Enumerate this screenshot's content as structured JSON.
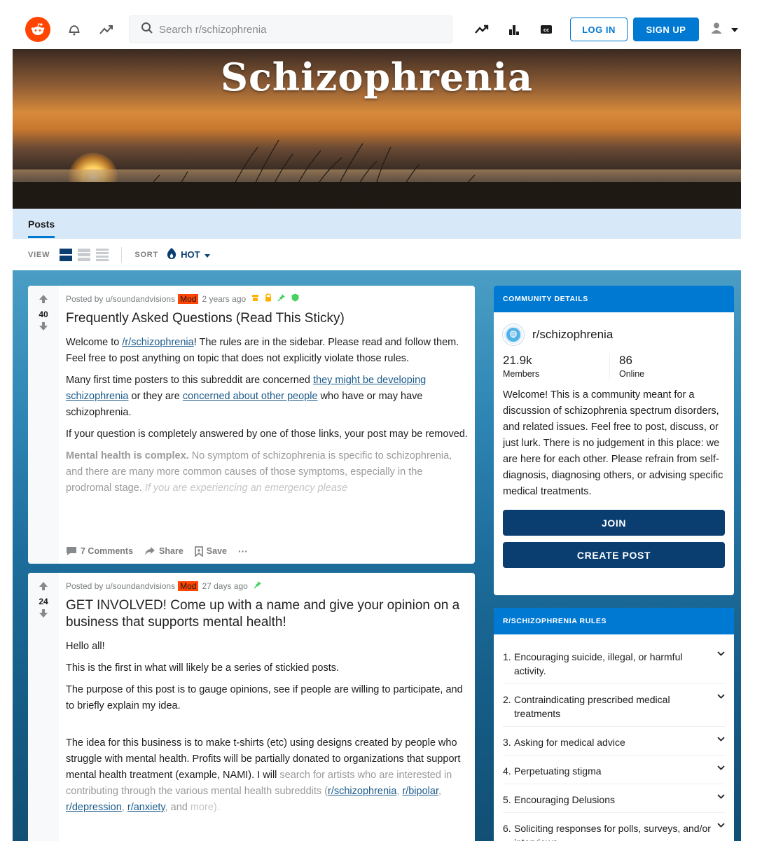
{
  "header": {
    "search_placeholder": "Search r/schizophrenia",
    "login_label": "LOG IN",
    "signup_label": "SIGN UP",
    "icons": [
      "reddit-logo",
      "notification-icon",
      "popular-icon",
      "search-icon",
      "trending-icon",
      "leaderboard-icon",
      "captions-icon",
      "user-icon",
      "chevron-down-icon"
    ]
  },
  "banner": {
    "title": "Schizophrenia"
  },
  "tabs": [
    {
      "label": "Posts",
      "active": true
    }
  ],
  "toolbar": {
    "view_label": "VIEW",
    "sort_label": "SORT",
    "sort_value": "HOT"
  },
  "colors": {
    "accent": "#0079d3",
    "dark_button": "#0a3d70",
    "mod_badge": "#ff4500",
    "tab_bar": "#d7e8f8"
  },
  "posts": [
    {
      "score": "40",
      "posted_by": "Posted by u/soundandvisions",
      "badge": "Mod",
      "age": "2 years ago",
      "title": "Frequently Asked Questions (Read This Sticky)",
      "p1_a": "Welcome to ",
      "p1_link": "/r/schizophrenia",
      "p1_b": "! The rules are in the sidebar. Please read and follow them. Feel free to post anything on topic that does not explicitly violate those rules.",
      "p2_a": "Many first time posters to this subreddit are concerned ",
      "p2_link1": "they might be developing schizophrenia",
      "p2_b": " or they are ",
      "p2_link2": "concerned about other people",
      "p2_c": " who have or may have schizophrenia.",
      "p3": "If your question is completely answered by one of those links, your post may be removed.",
      "p4_bold": "Mental health is complex.",
      "p4_a": " No symptom of schizophrenia is specific to schizophrenia, and there are many more common causes of those symptoms, especially in the prodromal stage. ",
      "p4_italic": "If you are experiencing an emergency please",
      "comments": "7 Comments",
      "share": "Share",
      "save": "Save",
      "more": "···"
    },
    {
      "score": "24",
      "posted_by": "Posted by u/soundandvisions",
      "badge": "Mod",
      "age": "27 days ago",
      "title": "GET INVOLVED! Come up with a name and give your opinion on a business that supports mental health!",
      "p1": "Hello all!",
      "p2": "This is the first in what will likely be a series of stickied posts.",
      "p3": "The purpose of this post is to gauge opinions, see if people are willing to participate, and to briefly explain my idea.",
      "p4_a": "The idea for this business is to make t-shirts (etc) using designs created by people who struggle with mental health. Profits will be partially donated to organizations that support mental health treatment (example, NAMI). I will ",
      "p4_b": "search for artists who are interested in contributing through the various mental health subreddits (",
      "p4_l1": "r/schizophrenia",
      "p4_l2": "r/bipolar",
      "p4_l3": "r/depression",
      "p4_l4": "r/anxiety",
      "p4_c": ", and",
      "p4_d": "more)."
    }
  ],
  "sidebar": {
    "community_header": "COMMUNITY DETAILS",
    "community_name": "r/schizophrenia",
    "members_count": "21.9k",
    "members_label": "Members",
    "online_count": "86",
    "online_label": "Online",
    "description": "Welcome! This is a community meant for a discussion of schizophrenia spectrum disorders, and related issues. Feel free to post, discuss, or just lurk. There is no judgement in this place: we are here for each other. Please refrain from self-diagnosis, diagnosing others, or advising specific medical treatments.",
    "join_label": "JOIN",
    "create_post_label": "CREATE POST",
    "rules_header": "R/SCHIZOPHRENIA RULES",
    "rules": [
      {
        "num": "1.",
        "text": "Encouraging suicide, illegal, or harmful activity."
      },
      {
        "num": "2.",
        "text": "Contraindicating prescribed medical treatments"
      },
      {
        "num": "3.",
        "text": "Asking for medical advice"
      },
      {
        "num": "4.",
        "text": "Perpetuating stigma"
      },
      {
        "num": "5.",
        "text": "Encouraging Delusions"
      },
      {
        "num": "6.",
        "text": "Soliciting responses for polls, surveys, and/or interviews"
      }
    ]
  }
}
